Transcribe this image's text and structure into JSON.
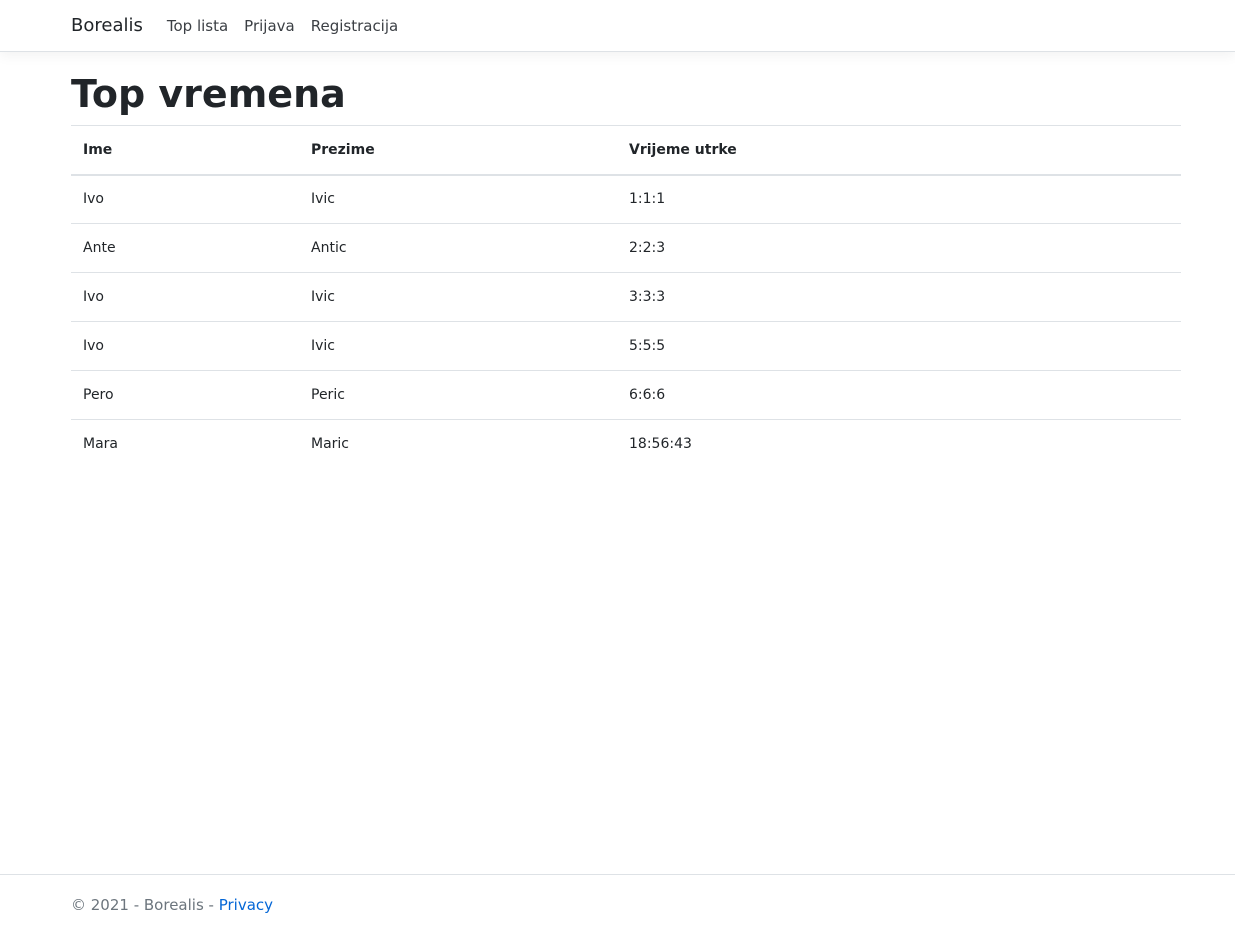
{
  "nav": {
    "brand": "Borealis",
    "links": [
      "Top lista",
      "Prijava",
      "Registracija"
    ]
  },
  "page": {
    "title": "Top vremena"
  },
  "table": {
    "headers": [
      "Ime",
      "Prezime",
      "Vrijeme utrke"
    ],
    "rows": [
      [
        "Ivo",
        "Ivic",
        "1:1:1"
      ],
      [
        "Ante",
        "Antic",
        "2:2:3"
      ],
      [
        "Ivo",
        "Ivic",
        "3:3:3"
      ],
      [
        "Ivo",
        "Ivic",
        "5:5:5"
      ],
      [
        "Pero",
        "Peric",
        "6:6:6"
      ],
      [
        "Mara",
        "Maric",
        "18:56:43"
      ]
    ]
  },
  "footer": {
    "text": "© 2021 - Borealis - ",
    "privacy": "Privacy"
  }
}
